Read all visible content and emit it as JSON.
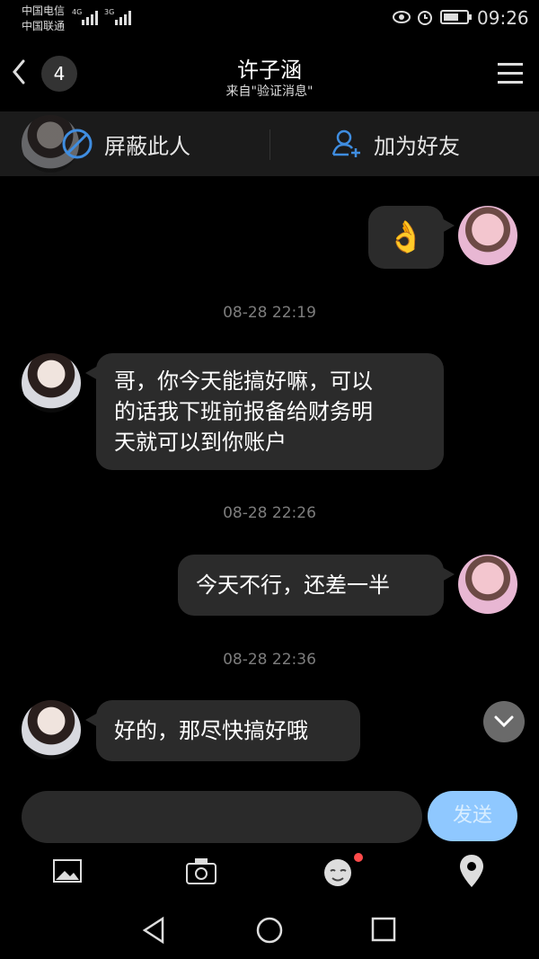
{
  "status": {
    "carrier_line1": "中国电信",
    "carrier_line2": "中国联通",
    "net1": "4G",
    "net2": "3G",
    "time": "09:26"
  },
  "header": {
    "title": "许子涵",
    "subtitle": "来自\"验证消息\"",
    "badge": "4"
  },
  "actions": {
    "block": "屏蔽此人",
    "add_friend": "加为好友"
  },
  "messages": [
    {
      "side": "right",
      "type": "emoji",
      "text": "👌"
    },
    {
      "type": "timestamp",
      "text": "08-28 22:19"
    },
    {
      "side": "left",
      "lines": [
        "哥，你今天能搞好嘛，可以",
        "的话我下班前报备给财务明",
        "天就可以到你账户"
      ]
    },
    {
      "type": "timestamp",
      "text": "08-28 22:26"
    },
    {
      "side": "right",
      "text": "今天不行，还差一半"
    },
    {
      "type": "timestamp",
      "text": "08-28 22:36"
    },
    {
      "side": "left",
      "text": "好的，那尽快搞好哦"
    }
  ],
  "input": {
    "send_label": "发送"
  },
  "icons": {
    "back": "chevron-left-icon",
    "menu": "hamburger-menu-icon",
    "block": "block-circle-icon",
    "add_friend": "add-user-icon",
    "scroll": "chevron-down-icon",
    "image": "image-icon",
    "camera": "camera-icon",
    "emoji": "emoji-icon",
    "location": "location-pin-icon",
    "nav_back": "nav-back-icon",
    "nav_home": "nav-home-icon",
    "nav_recent": "nav-recent-icon"
  },
  "colors": {
    "background": "#000000",
    "bubble": "#2b2b2b",
    "send_button": "#8fc8ff",
    "accent_icon": "#3f8de0",
    "badge_dot": "#ff4b4b"
  }
}
